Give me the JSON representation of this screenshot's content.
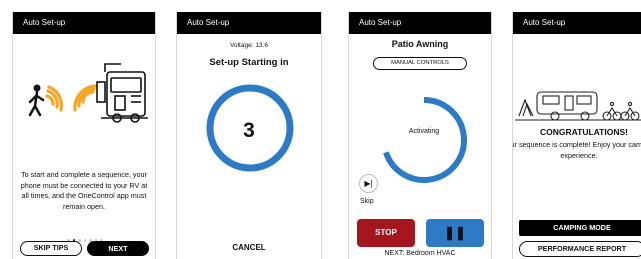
{
  "screens": [
    {
      "title": "Auto Set-up",
      "body": "To start and complete a sequence, your phone must be connected to your RV at all times, and the OneControl app must remain open.",
      "pager": {
        "count": 7,
        "active": 1
      },
      "skip_tips_label": "SKIP TIPS",
      "next_label": "NEXT",
      "icons": [
        "walking-person-icon",
        "wifi-signal-icon",
        "rv-icon"
      ]
    },
    {
      "title": "Auto Set-up",
      "voltage": "Voltage: 13.6",
      "heading": "Set-up Starting in",
      "countdown": "3",
      "cancel_label": "CANCEL"
    },
    {
      "title": "Auto Set-up",
      "device": "Patio Awning",
      "manual_controls_label": "MANUAL CONTROLS",
      "progress_label": "Activating",
      "progress": 0.7,
      "skip_label": "Skip",
      "stop_label": "STOP",
      "next_step": "NEXT: Bedroom HVAC",
      "colors": {
        "stop": "#a5151e",
        "pause": "#2d7bc6",
        "ring": "#2d7bc6"
      }
    },
    {
      "title": "Auto Set-up",
      "congrats": "CONGRATULATIONS!",
      "message": "Your sequence is complete! Enjoy your camping experience.",
      "camping_mode_label": "CAMPING MODE",
      "performance_report_label": "PERFORMANCE REPORT"
    }
  ],
  "accent": "#f5a623"
}
